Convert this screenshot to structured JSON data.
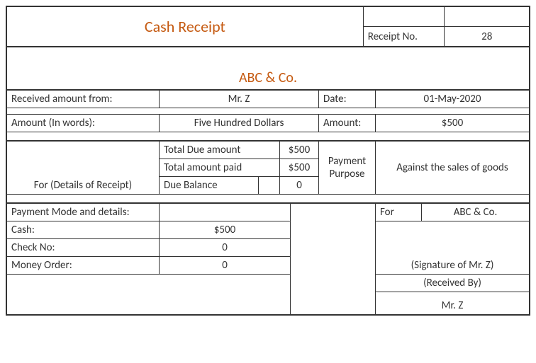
{
  "title": "Cash Receipt",
  "receipt_no_label": "Receipt No.",
  "receipt_no": "28",
  "company": "ABC & Co.",
  "received_from_label": "Received amount from:",
  "received_from": "Mr. Z",
  "date_label": "Date:",
  "date": "01-May-2020",
  "amount_words_label": "Amount (In words):",
  "amount_words": "Five Hundred Dollars",
  "amount_label": "Amount:",
  "amount": "$500",
  "details_label": "For (Details of Receipt)",
  "total_due_label": "Total Due amount",
  "total_due": "$500",
  "total_paid_label": "Total amount paid",
  "total_paid": "$500",
  "due_balance_label": "Due Balance",
  "due_balance": "0",
  "payment_purpose_label": "Payment Purpose",
  "payment_purpose": "Against the sales of goods",
  "payment_mode_label": "Payment Mode and details:",
  "cash_label": "Cash:",
  "cash": "$500",
  "check_label": "Check No:",
  "check": "0",
  "money_order_label": "Money Order:",
  "money_order": "0",
  "for_label": "For",
  "for_company": "ABC & Co.",
  "signature_of": "(Signature of Mr. Z)",
  "received_by_label": "(Received By)",
  "received_by": "Mr. Z"
}
